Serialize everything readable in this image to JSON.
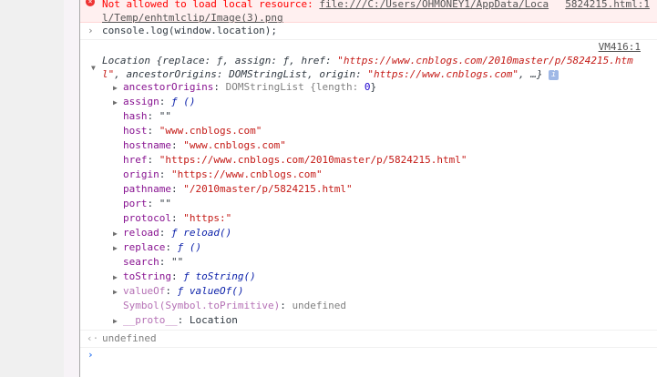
{
  "error": {
    "message": "Not allowed to load local resource:",
    "url_line1": "file:///C:/Users/OHMONEY1/AppData/Loca",
    "url_line2": "l/Temp/enhtmlclip/Image(3).png",
    "source": "5824215.html:1"
  },
  "command": "console.log(window.location);",
  "vm_source": "VM416:1",
  "summary": {
    "prefix": "Location {replace: ƒ, assign: ƒ, href: ",
    "href": "\"https://www.cnblogs.com/2010master/p/5824215.htm",
    "href_cont": "l\"",
    "mid": ", ancestorOrigins: DOMStringList, origin: ",
    "origin": "\"https://www.cnblogs.com\"",
    "suffix": ", …}"
  },
  "props": {
    "ancestorOrigins": {
      "key": "ancestorOrigins",
      "value": "DOMStringList {length: ",
      "num": "0",
      "end": "}"
    },
    "assign": {
      "key": "assign",
      "value": "ƒ ()"
    },
    "hash": {
      "key": "hash",
      "value": "\"\""
    },
    "host": {
      "key": "host",
      "value": "\"www.cnblogs.com\""
    },
    "hostname": {
      "key": "hostname",
      "value": "\"www.cnblogs.com\""
    },
    "href": {
      "key": "href",
      "value": "\"https://www.cnblogs.com/2010master/p/5824215.html\""
    },
    "origin": {
      "key": "origin",
      "value": "\"https://www.cnblogs.com\""
    },
    "pathname": {
      "key": "pathname",
      "value": "\"/2010master/p/5824215.html\""
    },
    "port": {
      "key": "port",
      "value": "\"\""
    },
    "protocol": {
      "key": "protocol",
      "value": "\"https:\""
    },
    "reload": {
      "key": "reload",
      "value": "ƒ reload()"
    },
    "replace": {
      "key": "replace",
      "value": "ƒ ()"
    },
    "search": {
      "key": "search",
      "value": "\"\""
    },
    "toString": {
      "key": "toString",
      "value": "ƒ toString()"
    },
    "valueOf": {
      "key": "valueOf",
      "value": "ƒ valueOf()"
    },
    "symbol": {
      "key": "Symbol(Symbol.toPrimitive)",
      "value": "undefined"
    },
    "proto": {
      "key": "__proto__",
      "value": "Location"
    }
  },
  "result": "undefined",
  "colon": ": "
}
